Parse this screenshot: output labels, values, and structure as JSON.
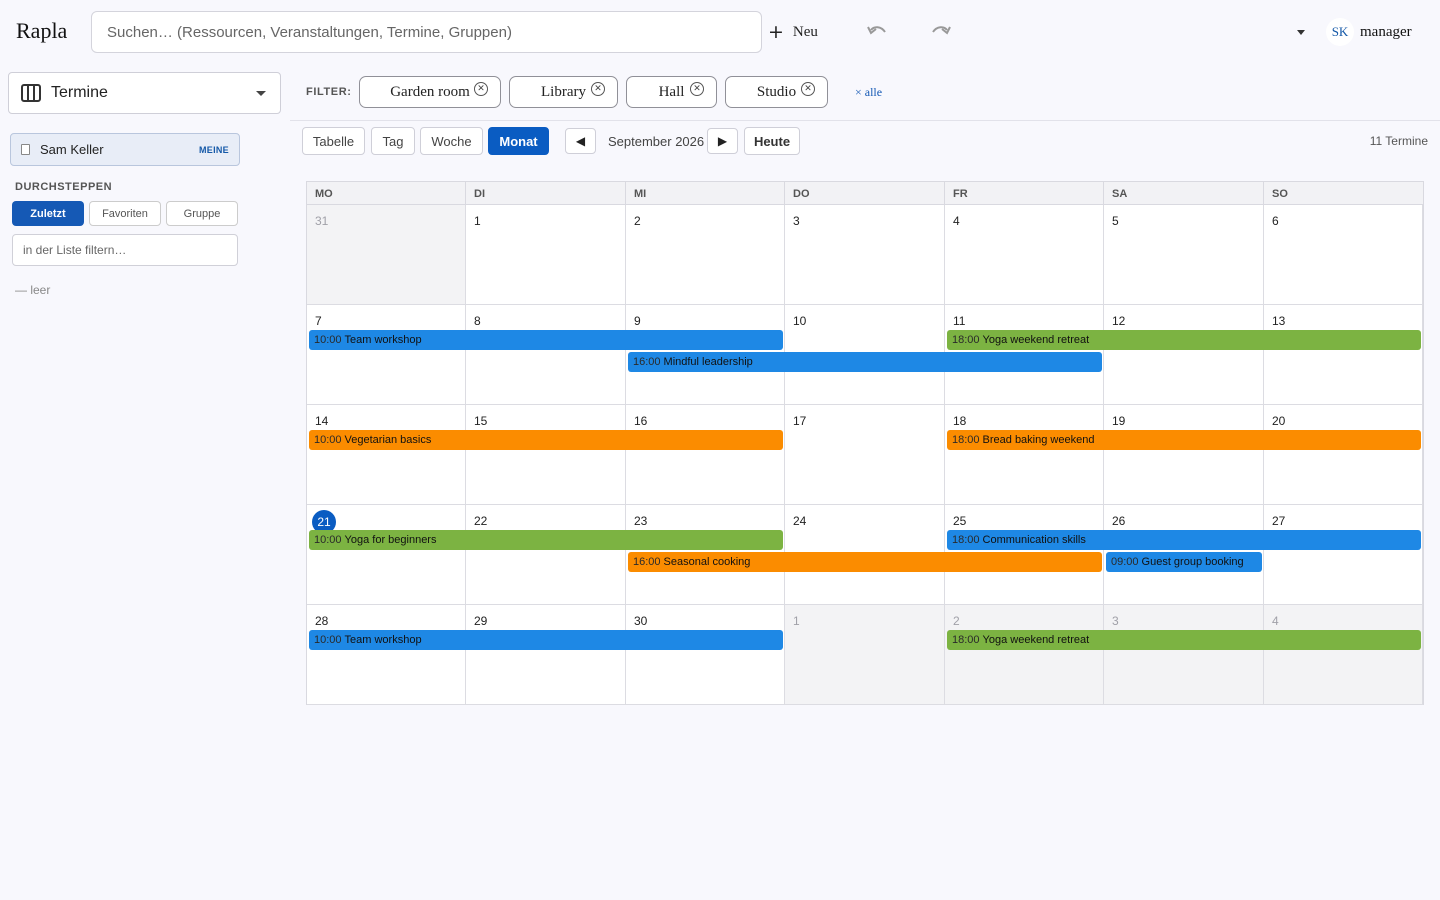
{
  "header": {
    "app_title": "Rapla",
    "search_placeholder": "Suchen… (Ressourcen, Veranstaltungen, Termine, Gruppen)",
    "new_label": "Neu",
    "user_initials": "SK",
    "user_name": "manager"
  },
  "sidebar": {
    "view_select": "Termine",
    "owner": {
      "name": "Sam Keller",
      "badge": "MEINE"
    },
    "section_title": "DURCHSTEPPEN",
    "segments": [
      "Zuletzt",
      "Favoriten",
      "Gruppe"
    ],
    "active_segment": "Zuletzt",
    "list_filter_placeholder": "in der Liste filtern…",
    "empty_note": "— leer"
  },
  "filter": {
    "label": "FILTER:",
    "chips": [
      "Garden room",
      "Library",
      "Hall",
      "Studio"
    ],
    "clear_all": "× alle"
  },
  "toolbar": {
    "views": [
      "Tabelle",
      "Tag",
      "Woche",
      "Monat"
    ],
    "active_view": "Monat",
    "period": "September 2026",
    "prev_icon": "◀",
    "next_icon": "▶",
    "today": "Heute",
    "count": "11 Termine"
  },
  "calendar": {
    "weekdays": [
      "MO",
      "DI",
      "MI",
      "DO",
      "FR",
      "SA",
      "SO"
    ],
    "weeks": [
      [
        {
          "d": "31",
          "out": true
        },
        {
          "d": "1"
        },
        {
          "d": "2"
        },
        {
          "d": "3"
        },
        {
          "d": "4"
        },
        {
          "d": "5"
        },
        {
          "d": "6"
        }
      ],
      [
        {
          "d": "7"
        },
        {
          "d": "8"
        },
        {
          "d": "9"
        },
        {
          "d": "10"
        },
        {
          "d": "11"
        },
        {
          "d": "12"
        },
        {
          "d": "13"
        }
      ],
      [
        {
          "d": "14"
        },
        {
          "d": "15"
        },
        {
          "d": "16"
        },
        {
          "d": "17"
        },
        {
          "d": "18"
        },
        {
          "d": "19"
        },
        {
          "d": "20"
        }
      ],
      [
        {
          "d": "21",
          "today": true
        },
        {
          "d": "22"
        },
        {
          "d": "23"
        },
        {
          "d": "24"
        },
        {
          "d": "25"
        },
        {
          "d": "26"
        },
        {
          "d": "27"
        }
      ],
      [
        {
          "d": "28"
        },
        {
          "d": "29"
        },
        {
          "d": "30"
        },
        {
          "d": "1",
          "out": true
        },
        {
          "d": "2",
          "out": true
        },
        {
          "d": "3",
          "out": true
        },
        {
          "d": "4",
          "out": true
        }
      ]
    ],
    "colors": {
      "blue": "#1e88e5",
      "green": "#7cb342",
      "orange": "#fb8c00"
    },
    "events": [
      {
        "week": 1,
        "start": 0,
        "span": 3,
        "lane": 0,
        "time": "10:00",
        "title": "Team workshop",
        "color": "blue"
      },
      {
        "week": 1,
        "start": 4,
        "span": 3,
        "lane": 0,
        "time": "18:00",
        "title": "Yoga weekend retreat",
        "color": "green"
      },
      {
        "week": 1,
        "start": 2,
        "span": 3,
        "lane": 1,
        "time": "16:00",
        "title": "Mindful leadership",
        "color": "blue"
      },
      {
        "week": 2,
        "start": 0,
        "span": 3,
        "lane": 0,
        "time": "10:00",
        "title": "Vegetarian basics",
        "color": "orange"
      },
      {
        "week": 2,
        "start": 4,
        "span": 3,
        "lane": 0,
        "time": "18:00",
        "title": "Bread baking weekend",
        "color": "orange"
      },
      {
        "week": 3,
        "start": 0,
        "span": 3,
        "lane": 0,
        "time": "10:00",
        "title": "Yoga for beginners",
        "color": "green"
      },
      {
        "week": 3,
        "start": 4,
        "span": 3,
        "lane": 0,
        "time": "18:00",
        "title": "Communication skills",
        "color": "blue"
      },
      {
        "week": 3,
        "start": 2,
        "span": 3,
        "lane": 1,
        "time": "16:00",
        "title": "Seasonal cooking",
        "color": "orange"
      },
      {
        "week": 3,
        "start": 5,
        "span": 1,
        "lane": 1,
        "time": "09:00",
        "title": "Guest group booking",
        "color": "blue"
      },
      {
        "week": 4,
        "start": 0,
        "span": 3,
        "lane": 0,
        "time": "10:00",
        "title": "Team workshop",
        "color": "blue"
      },
      {
        "week": 4,
        "start": 4,
        "span": 3,
        "lane": 0,
        "time": "18:00",
        "title": "Yoga weekend retreat",
        "color": "green"
      }
    ]
  }
}
